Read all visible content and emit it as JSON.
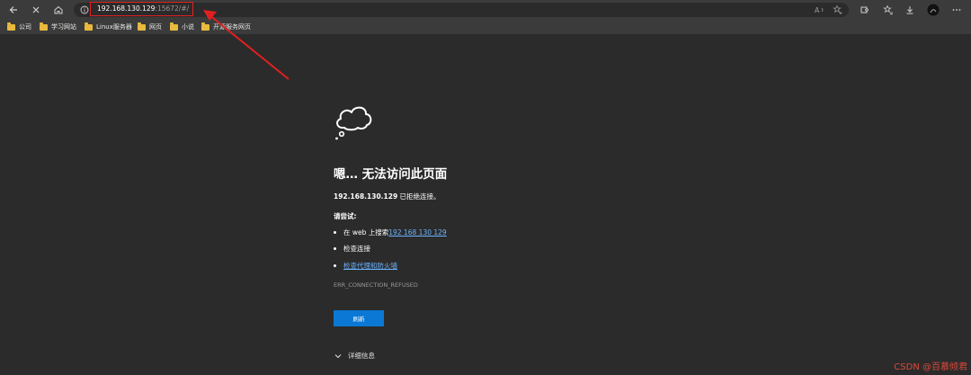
{
  "toolbar": {
    "back_icon": "back-arrow-icon",
    "close_icon": "close-icon",
    "home_icon": "home-icon",
    "info_icon": "info-icon"
  },
  "address": {
    "host": "192.168.130.129",
    "path": ":15672/#/"
  },
  "bookmarks": [
    {
      "label": "公司"
    },
    {
      "label": "学习网站"
    },
    {
      "label": "Linux服务器"
    },
    {
      "label": "网页"
    },
    {
      "label": "小说"
    },
    {
      "label": "开源服务网页"
    }
  ],
  "error": {
    "headline": "嗯… 无法访问此页面",
    "refused_host": "192.168.130.129",
    "refused_text": " 已拒绝连接。",
    "try_label": "请尝试:",
    "suggestion_search_prefix": "在 web 上搜索 ",
    "suggestion_search_link": "192 168 130 129",
    "suggestion_check": "检查连接",
    "suggestion_proxy": "检查代理和防火墙",
    "code": "ERR_CONNECTION_REFUSED",
    "refresh_label": "刷新",
    "details_label": "详细信息"
  },
  "watermark": "CSDN @百慕倾君",
  "colors": {
    "annotation": "#e02020",
    "link": "#6cb4ff",
    "button": "#0a78d4"
  }
}
